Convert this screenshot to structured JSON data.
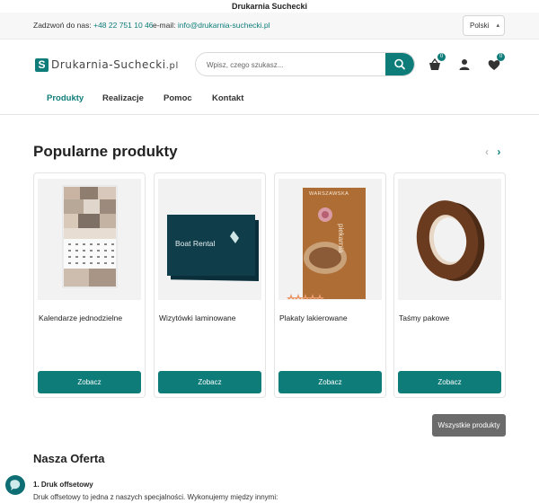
{
  "window": {
    "title": "Drukarnia Suchecki"
  },
  "topbar": {
    "phone_label": "Zadzwoń do nas:",
    "phone_number": "+48 22 751 10 46",
    "email_label": "e-mail:",
    "email_address": "info@drukarnia-suchecki.pl",
    "language": "Polski"
  },
  "header": {
    "logo_mark": "S",
    "logo_text": "Drukarnia-Suchecki",
    "logo_tld": ".pl",
    "search_placeholder": "Wpisz, czego szukasz...",
    "cart_count": "0",
    "wishlist_count": "0",
    "icons": [
      "search-icon",
      "cart-icon",
      "user-icon",
      "heart-icon"
    ]
  },
  "nav": {
    "items": [
      {
        "label": "Produkty",
        "active": true
      },
      {
        "label": "Realizacje",
        "active": false
      },
      {
        "label": "Pomoc",
        "active": false
      },
      {
        "label": "Kontakt",
        "active": false
      }
    ]
  },
  "popular": {
    "title": "Popularne produkty",
    "prev_arrow": "‹",
    "next_arrow": "›",
    "products": [
      {
        "name": "Kalendarze jednodzielne",
        "button": "Zobacz"
      },
      {
        "name": "Wizytówki laminowane",
        "button": "Zobacz",
        "image_text": "Boat Rental"
      },
      {
        "name": "Plakaty lakierowane",
        "button": "Zobacz",
        "image_text_top": "WARSZAWSKA",
        "image_text_side": "piekarnia"
      },
      {
        "name": "Taśmy pakowe",
        "button": "Zobacz"
      }
    ],
    "all_button": "Wszystkie produkty"
  },
  "offer": {
    "title": "Nasza Oferta",
    "item_title": "1. Druk offsetowy",
    "item_text": "Druk offsetowy to jedna z naszych specjalności. Wykonujemy między innymi:"
  },
  "colors": {
    "accent": "#0e7d7a",
    "secondary_button": "#6b6b6b"
  }
}
